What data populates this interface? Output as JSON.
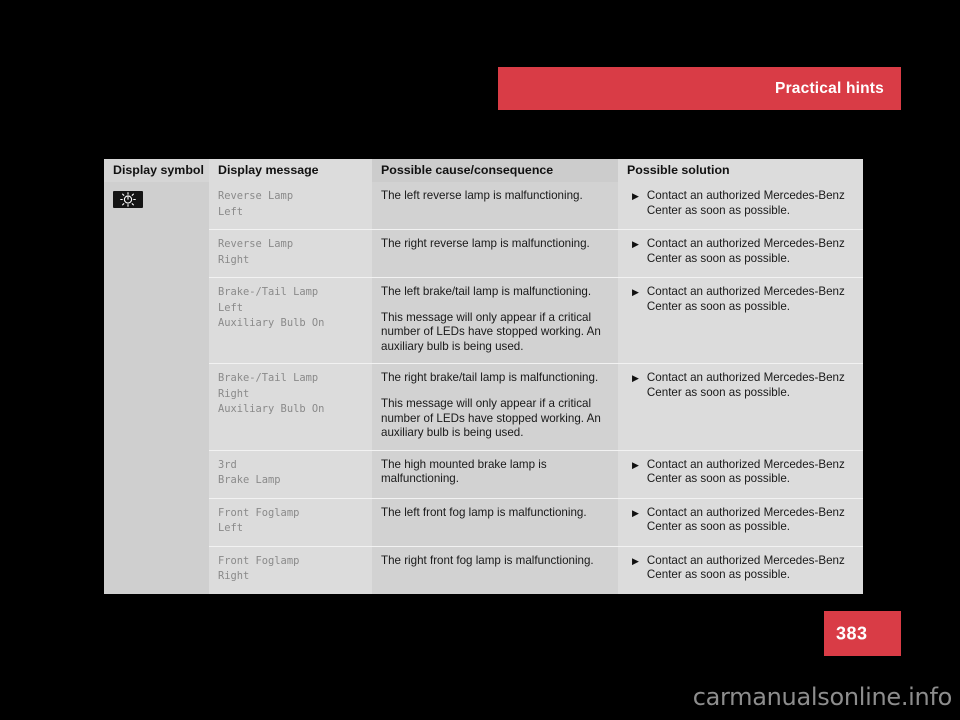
{
  "header": {
    "section_title": "Practical hints",
    "banner_color": "#d93c46"
  },
  "page": {
    "number": "383",
    "box_color": "#d93c46"
  },
  "watermark": {
    "text": "carmanualsonline.info"
  },
  "table": {
    "columns": [
      {
        "key": "symbol",
        "label": "Display symbol"
      },
      {
        "key": "message",
        "label": "Display message"
      },
      {
        "key": "cause",
        "label": "Possible cause/consequence"
      },
      {
        "key": "solution",
        "label": "Possible solution"
      }
    ],
    "symbol": {
      "icon_name": "lamp-bulb-indicator-icon",
      "background": "#141414"
    },
    "rows": [
      {
        "message": "Reverse Lamp\nLeft",
        "cause": [
          "The left reverse lamp is malfunctioning."
        ],
        "bullet": "▶",
        "solution": "Contact an authorized Mercedes-Benz Center as soon as possible."
      },
      {
        "message": "Reverse Lamp\nRight",
        "cause": [
          "The right reverse lamp is malfunctioning."
        ],
        "bullet": "▶",
        "solution": "Contact an authorized Mercedes-Benz Center as soon as possible."
      },
      {
        "message": "Brake-/Tail Lamp\nLeft\nAuxiliary Bulb On",
        "cause": [
          "The left brake/tail lamp is malfunctioning.",
          "This message will only appear if a critical number of LEDs have stopped working. An auxiliary bulb is being used."
        ],
        "bullet": "▶",
        "solution": "Contact an authorized Mercedes-Benz Center as soon as possible."
      },
      {
        "message": "Brake-/Tail Lamp\nRight\nAuxiliary Bulb On",
        "cause": [
          "The right brake/tail lamp is malfunctioning.",
          "This message will only appear if a critical number of LEDs have stopped working. An auxiliary bulb is being used."
        ],
        "bullet": "▶",
        "solution": "Contact an authorized Mercedes-Benz Center as soon as possible."
      },
      {
        "message": "3rd\nBrake Lamp",
        "cause": [
          "The high mounted brake lamp is malfunctioning."
        ],
        "bullet": "▶",
        "solution": "Contact an authorized Mercedes-Benz Center as soon as possible."
      },
      {
        "message": "Front Foglamp\nLeft",
        "cause": [
          "The left front fog lamp is malfunctioning."
        ],
        "bullet": "▶",
        "solution": "Contact an authorized Mercedes-Benz Center as soon as possible."
      },
      {
        "message": "Front Foglamp\nRight",
        "cause": [
          "The right front fog lamp is malfunctioning."
        ],
        "bullet": "▶",
        "solution": "Contact an authorized Mercedes-Benz Center as soon as possible."
      }
    ]
  }
}
